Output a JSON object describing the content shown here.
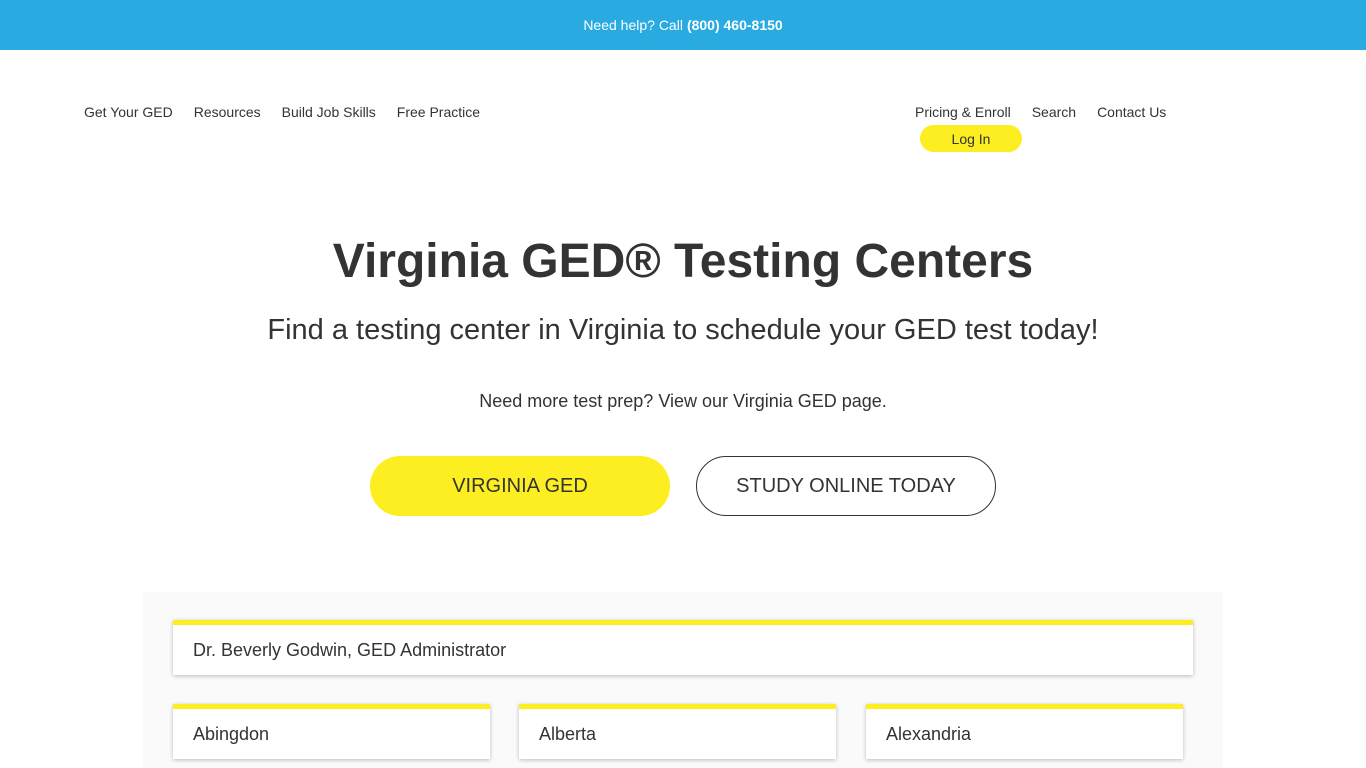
{
  "topbar": {
    "help_text": "Need help? Call",
    "phone": "(800) 460-8150"
  },
  "nav": {
    "left": [
      "Get Your GED",
      "Resources",
      "Build Job Skills",
      "Free Practice"
    ],
    "right": [
      "Pricing & Enroll",
      "Search",
      "Contact Us"
    ],
    "login": "Log In"
  },
  "hero": {
    "title": "Virginia GED® Testing Centers",
    "subtitle": "Find a testing center in Virginia to schedule your GED test today!",
    "prep_text": "Need more test prep? View our Virginia GED page.",
    "primary_button": "VIRGINIA GED",
    "secondary_button": "STUDY ONLINE TODAY"
  },
  "cards": {
    "admin": "Dr. Beverly Godwin, GED Administrator",
    "cities": [
      "Abingdon",
      "Alberta",
      "Alexandria"
    ]
  },
  "colors": {
    "topbar": "#29abe2",
    "accent": "#fcee21",
    "text": "#333333"
  }
}
